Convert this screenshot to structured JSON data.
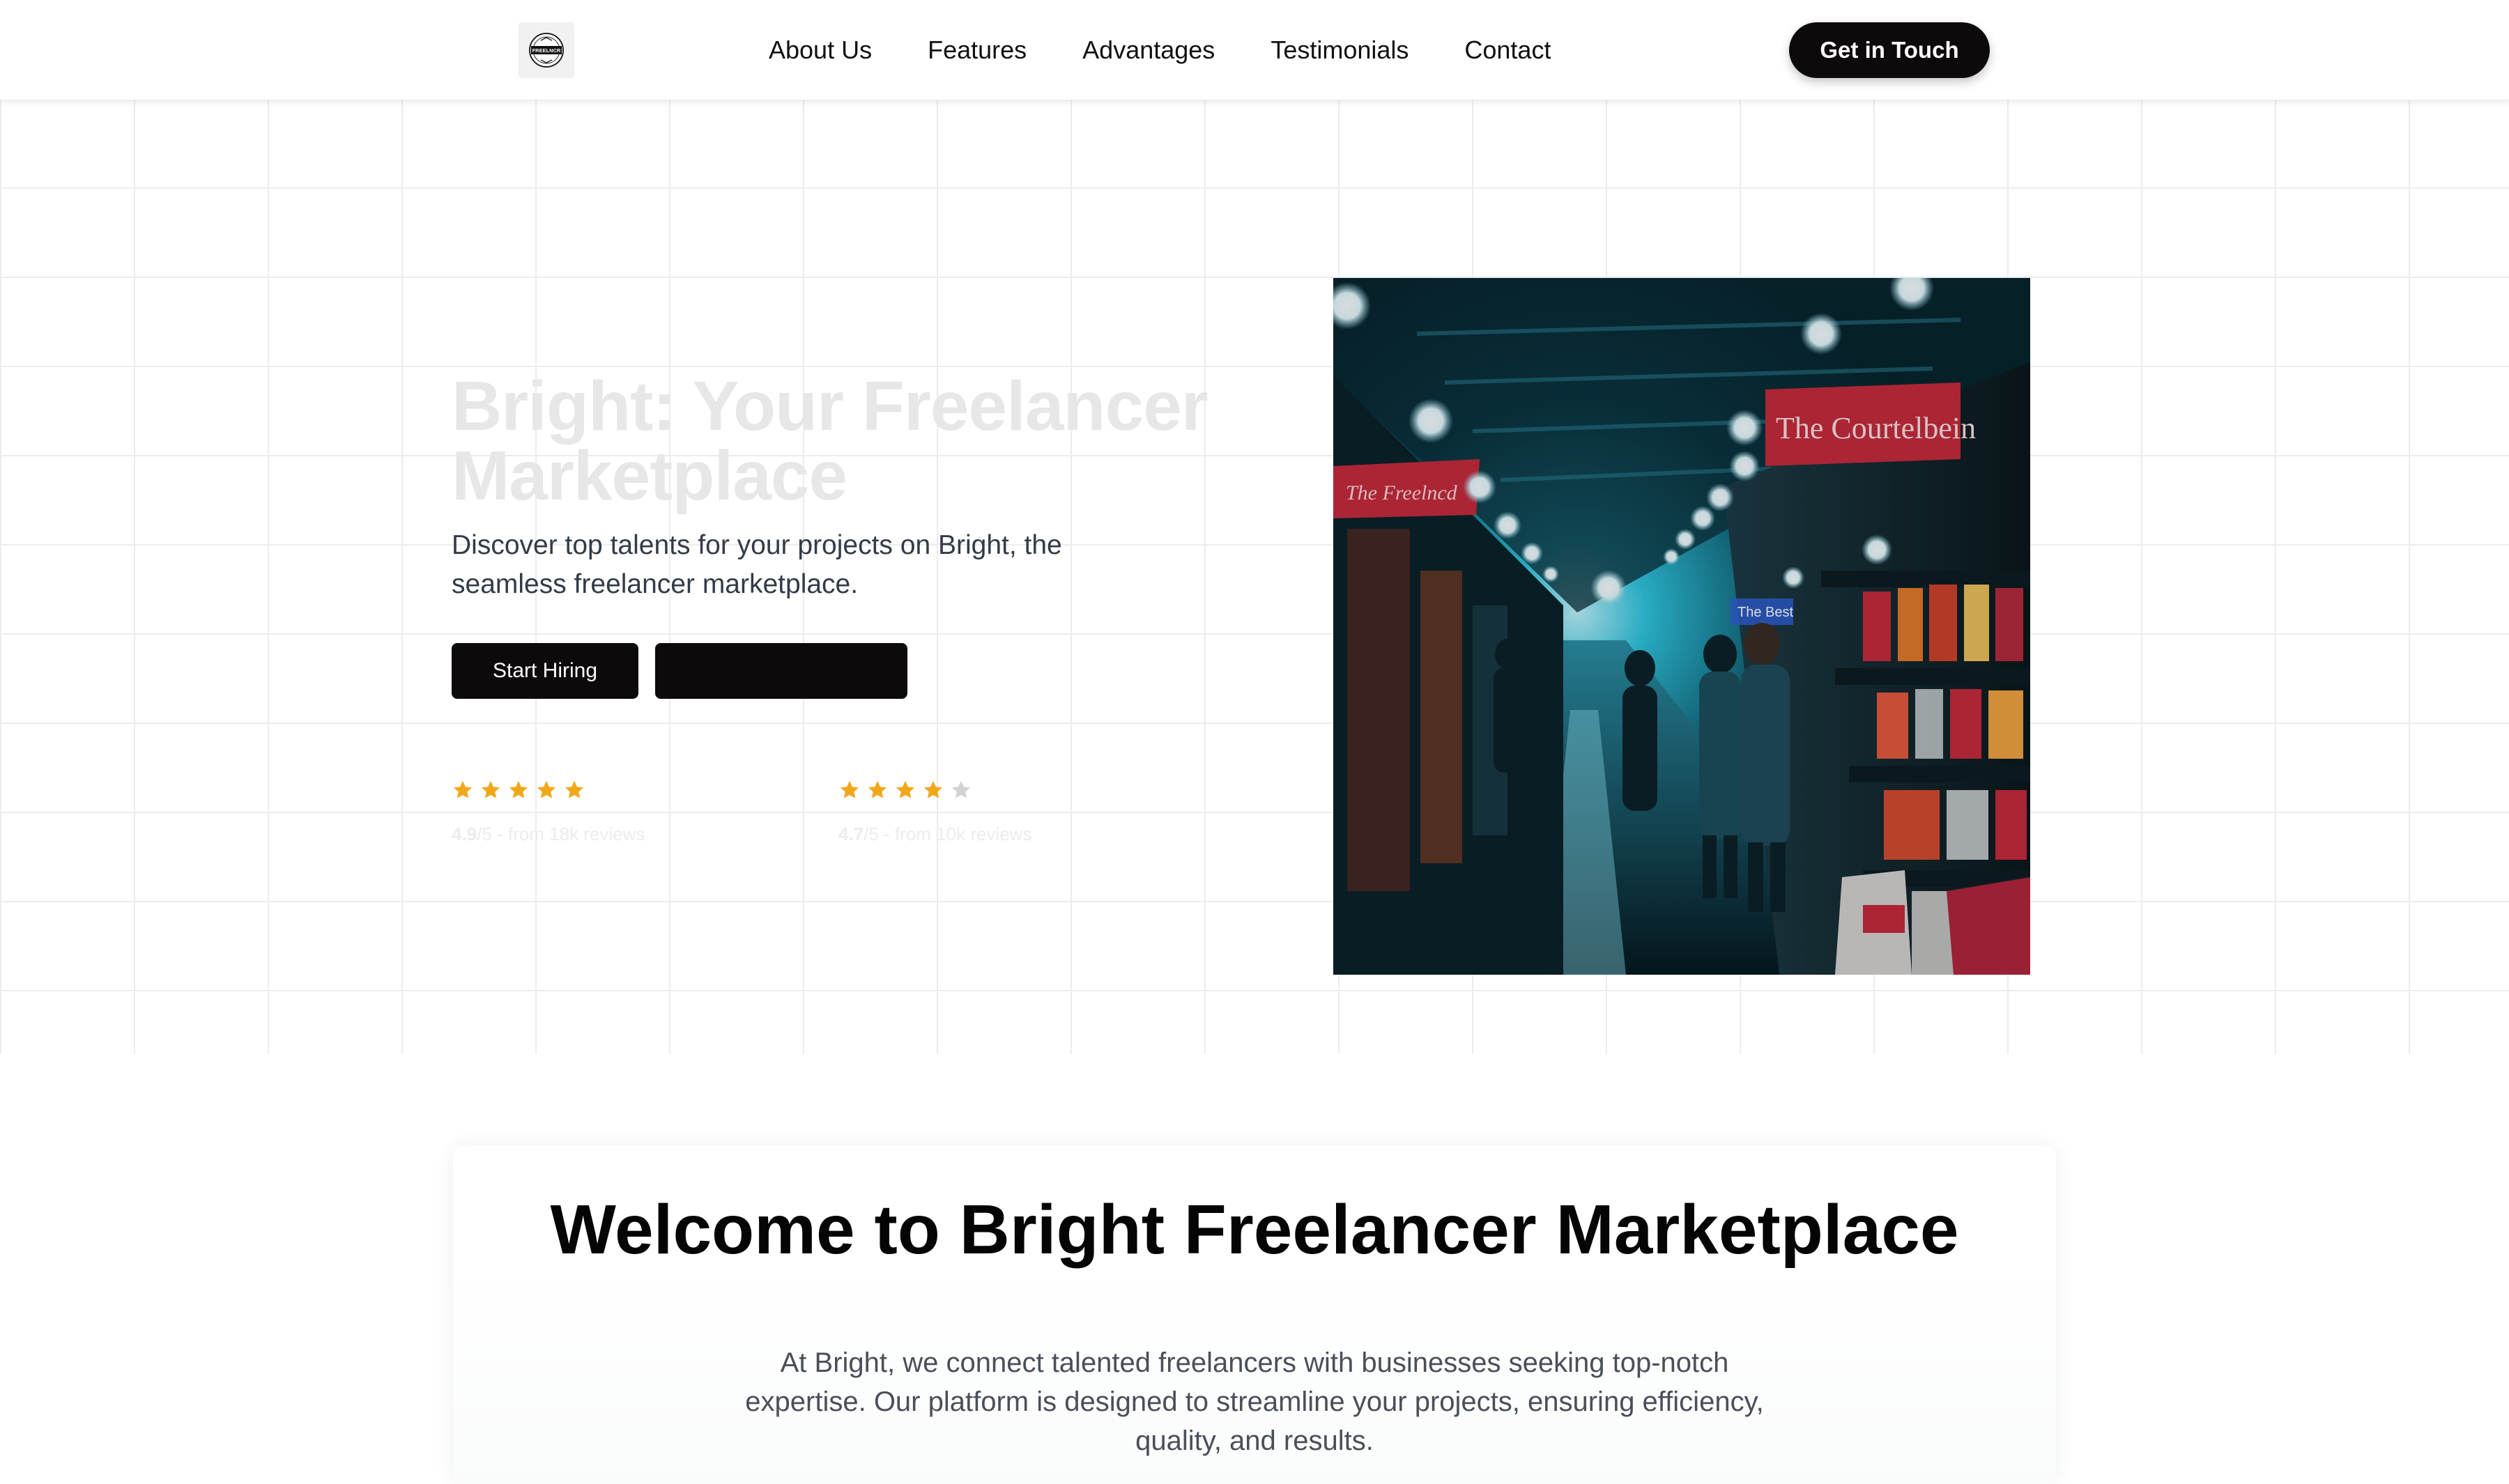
{
  "brand": {
    "logo_icon": "freelancer-badge-logo",
    "logo_text": "FREELNCR"
  },
  "nav": {
    "links": [
      "About Us",
      "Features",
      "Advantages",
      "Testimonials",
      "Contact"
    ],
    "cta_label": "Get in Touch"
  },
  "hero": {
    "title": "Bright: Your Freelancer Marketplace",
    "subtitle": "Discover top talents for your projects on Bright, the seamless freelancer marketplace.",
    "primary_button": "Start Hiring",
    "secondary_button": "",
    "ratings": [
      {
        "stars": 5,
        "score": "4.9",
        "scale": "/5",
        "source": " - from 18k reviews"
      },
      {
        "stars": 4,
        "score": "4.7",
        "scale": "/5",
        "source": " - from 10k reviews"
      }
    ],
    "image": {
      "description_icon": "market-street-photo",
      "sign_main": "The Courtelbein",
      "sign_left": "The Freelncd",
      "sign_small": "The Best"
    }
  },
  "welcome": {
    "title": "Welcome to Bright Freelancer Marketplace",
    "text": "At Bright, we connect talented freelancers with businesses seeking top-notch expertise. Our platform is designed to streamline your projects, ensuring efficiency, quality, and results."
  },
  "colors": {
    "primary_dark": "#0d0a0b",
    "star_filled": "#f0a81a",
    "star_empty": "#d3d3d3",
    "grid_line": "#ececec",
    "accent_red": "#c8283a",
    "photo_cyan": "#1fb7d2"
  }
}
